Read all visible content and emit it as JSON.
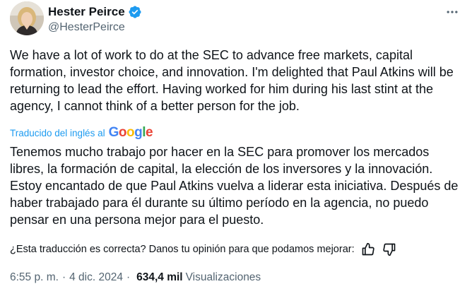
{
  "author": {
    "display_name": "Hester Peirce",
    "handle": "@HesterPeirce",
    "verified": true,
    "verified_color": "#1d9bf0"
  },
  "tweet": {
    "text": "We have a lot of work to do at the SEC to advance free markets, capital formation, investor choice, and innovation. I'm delighted that Paul Atkins will be returning to lead the effort. Having worked for him during his last stint at the agency, I cannot think of a better person for the job."
  },
  "translation": {
    "label": "Traducido del inglés al",
    "provider": "Google",
    "text": "Tenemos mucho trabajo por hacer en la SEC para promover los mercados libres, la formación de capital, la elección de los inversores y la innovación. Estoy encantado de que Paul Atkins vuelva a liderar esta iniciativa. Después de haber trabajado para él durante su último período en la agencia, no puedo pensar en una persona mejor para el puesto.",
    "feedback_prompt": "¿Esta traducción es correcta? Danos tu opinión para que podamos mejorar:"
  },
  "meta": {
    "time": "6:55 p. m.",
    "date": "4 dic. 2024",
    "separator": "·",
    "views_count": "634,4 mil",
    "views_label": "Visualizaciones"
  },
  "icons": {
    "more": "more-horizontal-icon",
    "verified": "verified-badge-icon",
    "thumbs_up": "thumbs-up-icon",
    "thumbs_down": "thumbs-down-icon"
  },
  "colors": {
    "link_blue": "#1d9bf0",
    "text_primary": "#0f1419",
    "text_secondary": "#536471"
  }
}
